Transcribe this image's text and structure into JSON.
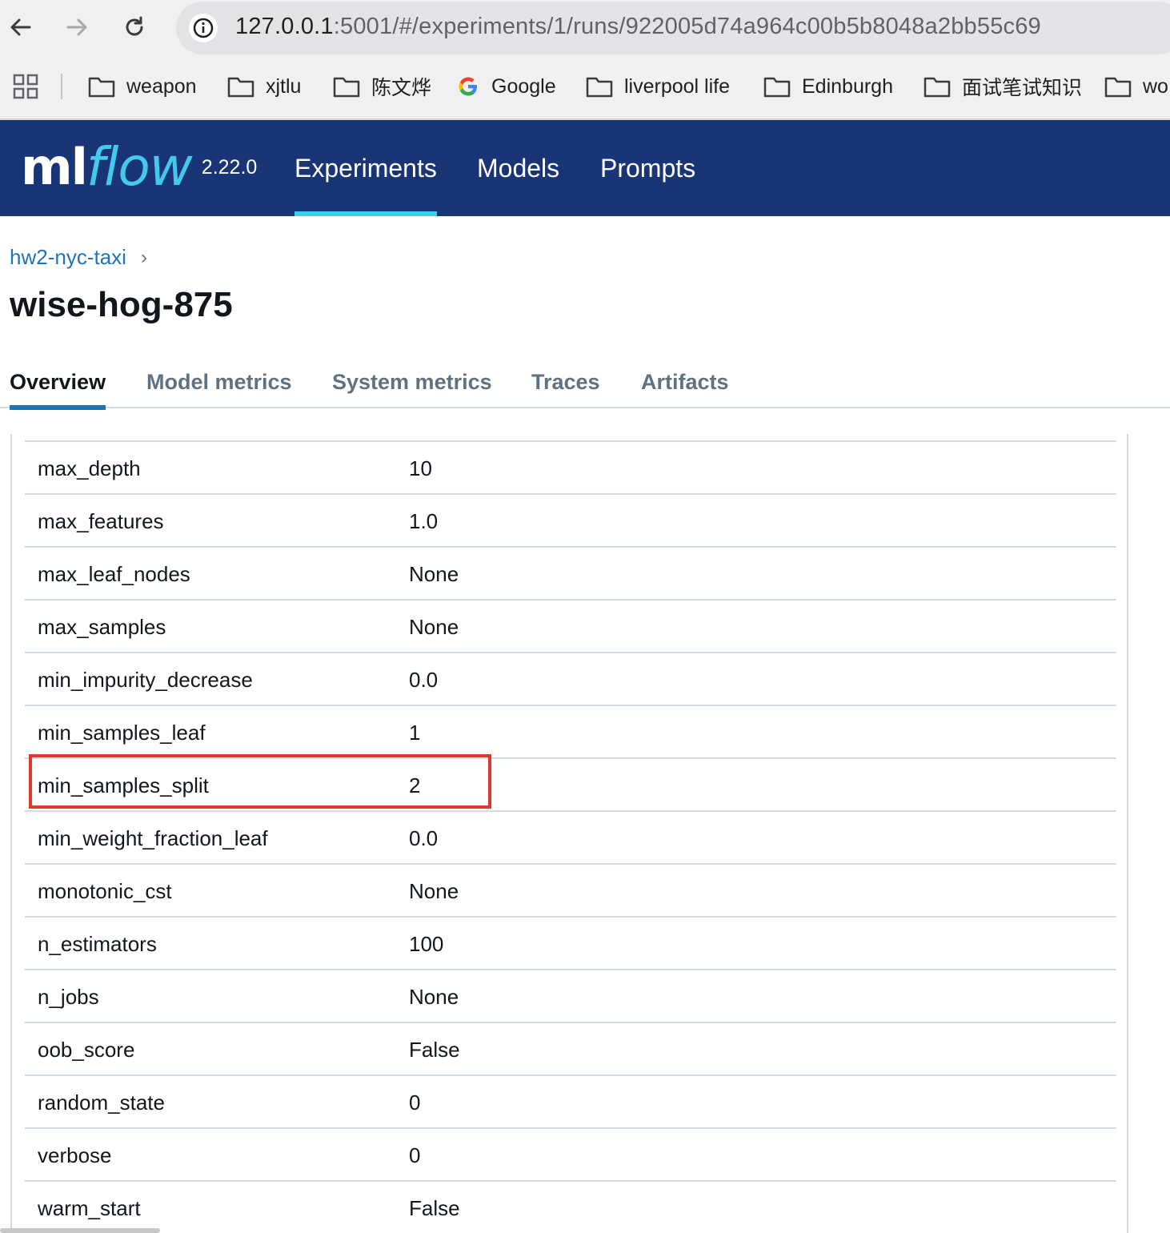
{
  "browser": {
    "url_host": "127.0.0.1",
    "url_rest": ":5001/#/experiments/1/runs/922005d74a964c00b5b8048a2bb55c69",
    "bookmarks": [
      "weapon",
      "xjtlu",
      "陈文烨",
      "Google",
      "liverpool life",
      "Edinburgh",
      "面试笔试知识",
      "wo"
    ]
  },
  "app": {
    "logo_ml": "ml",
    "logo_flow": "flow",
    "version": "2.22.0",
    "nav": [
      "Experiments",
      "Models",
      "Prompts"
    ]
  },
  "breadcrumb": {
    "experiment": "hw2-nyc-taxi"
  },
  "run": {
    "title": "wise-hog-875"
  },
  "tabs": [
    "Overview",
    "Model metrics",
    "System metrics",
    "Traces",
    "Artifacts"
  ],
  "params": [
    {
      "key": "max_depth",
      "value": "10"
    },
    {
      "key": "max_features",
      "value": "1.0"
    },
    {
      "key": "max_leaf_nodes",
      "value": "None"
    },
    {
      "key": "max_samples",
      "value": "None"
    },
    {
      "key": "min_impurity_decrease",
      "value": "0.0"
    },
    {
      "key": "min_samples_leaf",
      "value": "1"
    },
    {
      "key": "min_samples_split",
      "value": "2"
    },
    {
      "key": "min_weight_fraction_leaf",
      "value": "0.0"
    },
    {
      "key": "monotonic_cst",
      "value": "None"
    },
    {
      "key": "n_estimators",
      "value": "100"
    },
    {
      "key": "n_jobs",
      "value": "None"
    },
    {
      "key": "oob_score",
      "value": "False"
    },
    {
      "key": "random_state",
      "value": "0"
    },
    {
      "key": "verbose",
      "value": "0"
    },
    {
      "key": "warm_start",
      "value": "False"
    }
  ],
  "colors": {
    "header_bg": "#1a3575",
    "accent": "#43c9ed",
    "link": "#2272b4",
    "highlight": "#e0392b"
  }
}
